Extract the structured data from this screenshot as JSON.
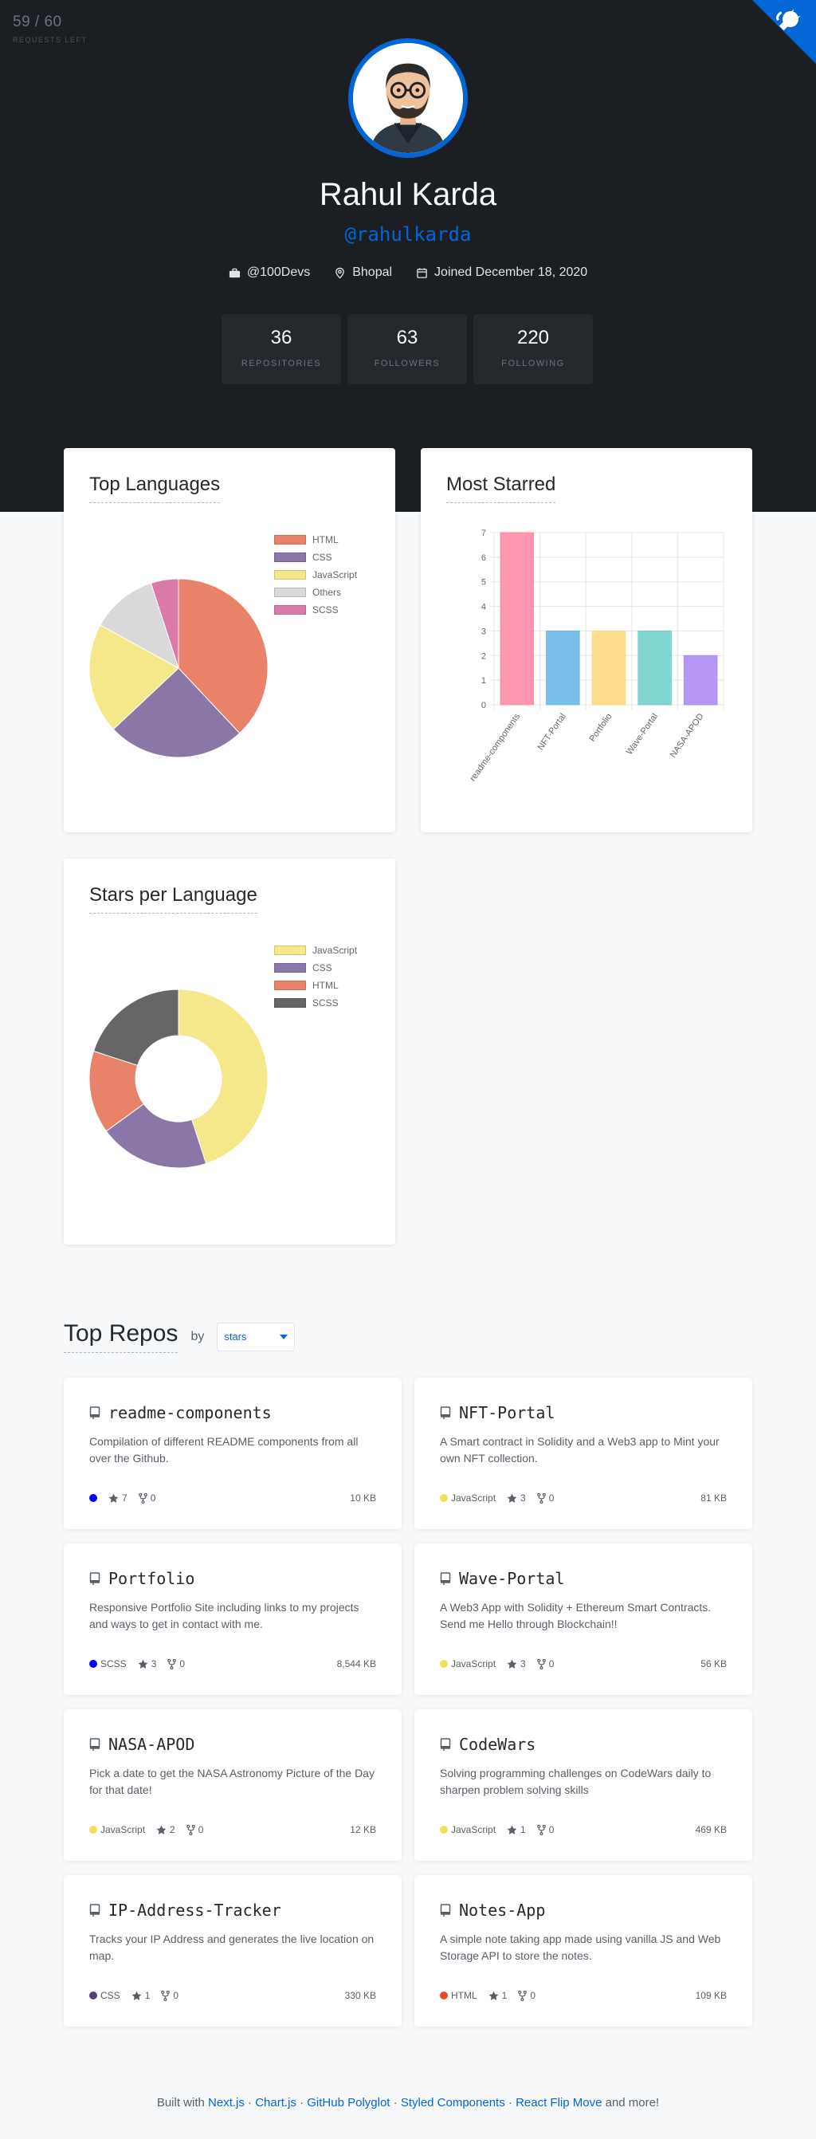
{
  "rate_limit": {
    "count": "59 / 60",
    "label": "REQUESTS LEFT"
  },
  "profile": {
    "name": "Rahul Karda",
    "login": "@rahulkarda",
    "company": "@100Devs",
    "location": "Bhopal",
    "joined": "Joined December 18, 2020"
  },
  "stats": [
    {
      "value": "36",
      "label": "REPOSITORIES"
    },
    {
      "value": "63",
      "label": "FOLLOWERS"
    },
    {
      "value": "220",
      "label": "FOLLOWING"
    }
  ],
  "charts": {
    "top_languages_title": "Top Languages",
    "most_starred_title": "Most Starred",
    "stars_per_language_title": "Stars per Language"
  },
  "chart_data": [
    {
      "type": "pie",
      "title": "Top Languages",
      "labels": [
        "HTML",
        "CSS",
        "JavaScript",
        "Others",
        "SCSS"
      ],
      "values": [
        38,
        25,
        20,
        12,
        5
      ],
      "colors": [
        "#e8836a",
        "#8b76a8",
        "#f5e88a",
        "#d9d9d9",
        "#d97aa8"
      ]
    },
    {
      "type": "bar",
      "title": "Most Starred",
      "categories": [
        "readme-components",
        "NFT-Portal",
        "Portfolio",
        "Wave-Portal",
        "NASA-APOD"
      ],
      "values": [
        7,
        3,
        3,
        3,
        2
      ],
      "colors": [
        "#ff8ca8",
        "#6cb8ea",
        "#ffd97f",
        "#72d0cb",
        "#ae8cf3"
      ],
      "ylim": [
        0,
        7
      ],
      "yticks": [
        "0",
        "1",
        "2",
        "3",
        "4",
        "5",
        "6",
        "7"
      ]
    },
    {
      "type": "pie",
      "title": "Stars per Language",
      "labels": [
        "JavaScript",
        "CSS",
        "HTML",
        "SCSS"
      ],
      "values": [
        9,
        4,
        3,
        4
      ],
      "colors": [
        "#f5e88a",
        "#8b76a8",
        "#e8836a",
        "#666666"
      ]
    }
  ],
  "top_repos": {
    "title": "Top Repos",
    "by": "by",
    "sort_value": "stars",
    "repos": [
      {
        "name": "readme-components",
        "desc": "Compilation of different README components from all over the Github.",
        "lang": "",
        "lang_color": "#0000ff",
        "stars": "7",
        "forks": "0",
        "size": "10 KB"
      },
      {
        "name": "NFT-Portal",
        "desc": "A Smart contract in Solidity and a Web3 app to Mint your own NFT collection.",
        "lang": "JavaScript",
        "lang_color": "#f1e05a",
        "stars": "3",
        "forks": "0",
        "size": "81 KB"
      },
      {
        "name": "Portfolio",
        "desc": "Responsive Portfolio Site including links to my projects and ways to get in contact with me.",
        "lang": "SCSS",
        "lang_color": "#0000ff",
        "stars": "3",
        "forks": "0",
        "size": "8,544 KB"
      },
      {
        "name": "Wave-Portal",
        "desc": "A Web3 App with Solidity + Ethereum Smart Contracts. Send me Hello through Blockchain!!",
        "lang": "JavaScript",
        "lang_color": "#f1e05a",
        "stars": "3",
        "forks": "0",
        "size": "56 KB"
      },
      {
        "name": "NASA-APOD",
        "desc": "Pick a date to get the NASA Astronomy Picture of the Day for that date!",
        "lang": "JavaScript",
        "lang_color": "#f1e05a",
        "stars": "2",
        "forks": "0",
        "size": "12 KB"
      },
      {
        "name": "CodeWars",
        "desc": "Solving programming challenges on CodeWars daily to sharpen problem solving skills",
        "lang": "JavaScript",
        "lang_color": "#f1e05a",
        "stars": "1",
        "forks": "0",
        "size": "469 KB"
      },
      {
        "name": "IP-Address-Tracker",
        "desc": "Tracks your IP Address and generates the live location on map.",
        "lang": "CSS",
        "lang_color": "#563d7c",
        "stars": "1",
        "forks": "0",
        "size": "330 KB"
      },
      {
        "name": "Notes-App",
        "desc": "A simple note taking app made using vanilla JS and Web Storage API to store the notes.",
        "lang": "HTML",
        "lang_color": "#e34c26",
        "stars": "1",
        "forks": "0",
        "size": "109 KB"
      }
    ]
  },
  "footer": {
    "prefix": "Built with",
    "links": [
      "Next.js",
      "Chart.js",
      "GitHub Polyglot",
      "Styled Components",
      "React Flip Move"
    ],
    "separator": " · ",
    "suffix": "and more!"
  }
}
